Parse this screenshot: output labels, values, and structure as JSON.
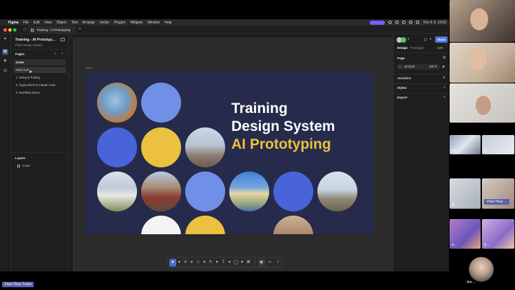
{
  "menubar": {
    "items": [
      "Figma",
      "File",
      "Edit",
      "View",
      "Object",
      "Text",
      "Arrange",
      "Vector",
      "Plugins",
      "Widgets",
      "Window",
      "Help"
    ],
    "clock": "Thu 4. 9. 13:02"
  },
  "figma": {
    "tab_title": "Training - AI Prototyping",
    "file_name": "Training - AI Prototyp...",
    "file_sub": "Plazo Design System",
    "pages_label": "Pages",
    "pages": [
      "Cover",
      "Start Here",
      "1. Setup & Tooling",
      "2. Figma MCP & Claude Code",
      "3. Workflow Demo"
    ],
    "layers_label": "Layers",
    "layers": [
      "Cover"
    ],
    "frame_label": "Cover",
    "slide": {
      "line1": "Training",
      "line2": "Design System",
      "line3": "AI Prototyping"
    },
    "right_panel": {
      "share_label": "Share",
      "tab_design": "Design",
      "tab_prototype": "Prototype",
      "zoom": "44%",
      "page_label": "Page",
      "page_color": "1E1E1E",
      "page_opacity": "100",
      "page_opacity_unit": "%",
      "variables_label": "Variables",
      "styles_label": "Styles",
      "export_label": "Export"
    },
    "help_label": "?"
  },
  "zoom_participants": {
    "names": [
      "Mo ...",
      "M ...",
      "Ar ...",
      "A ...",
      "R ...",
      "Am ..."
    ],
    "highlight_name": "Vlad-Titus ...",
    "presenter_tag": "Vlad-Titus Tudor"
  }
}
